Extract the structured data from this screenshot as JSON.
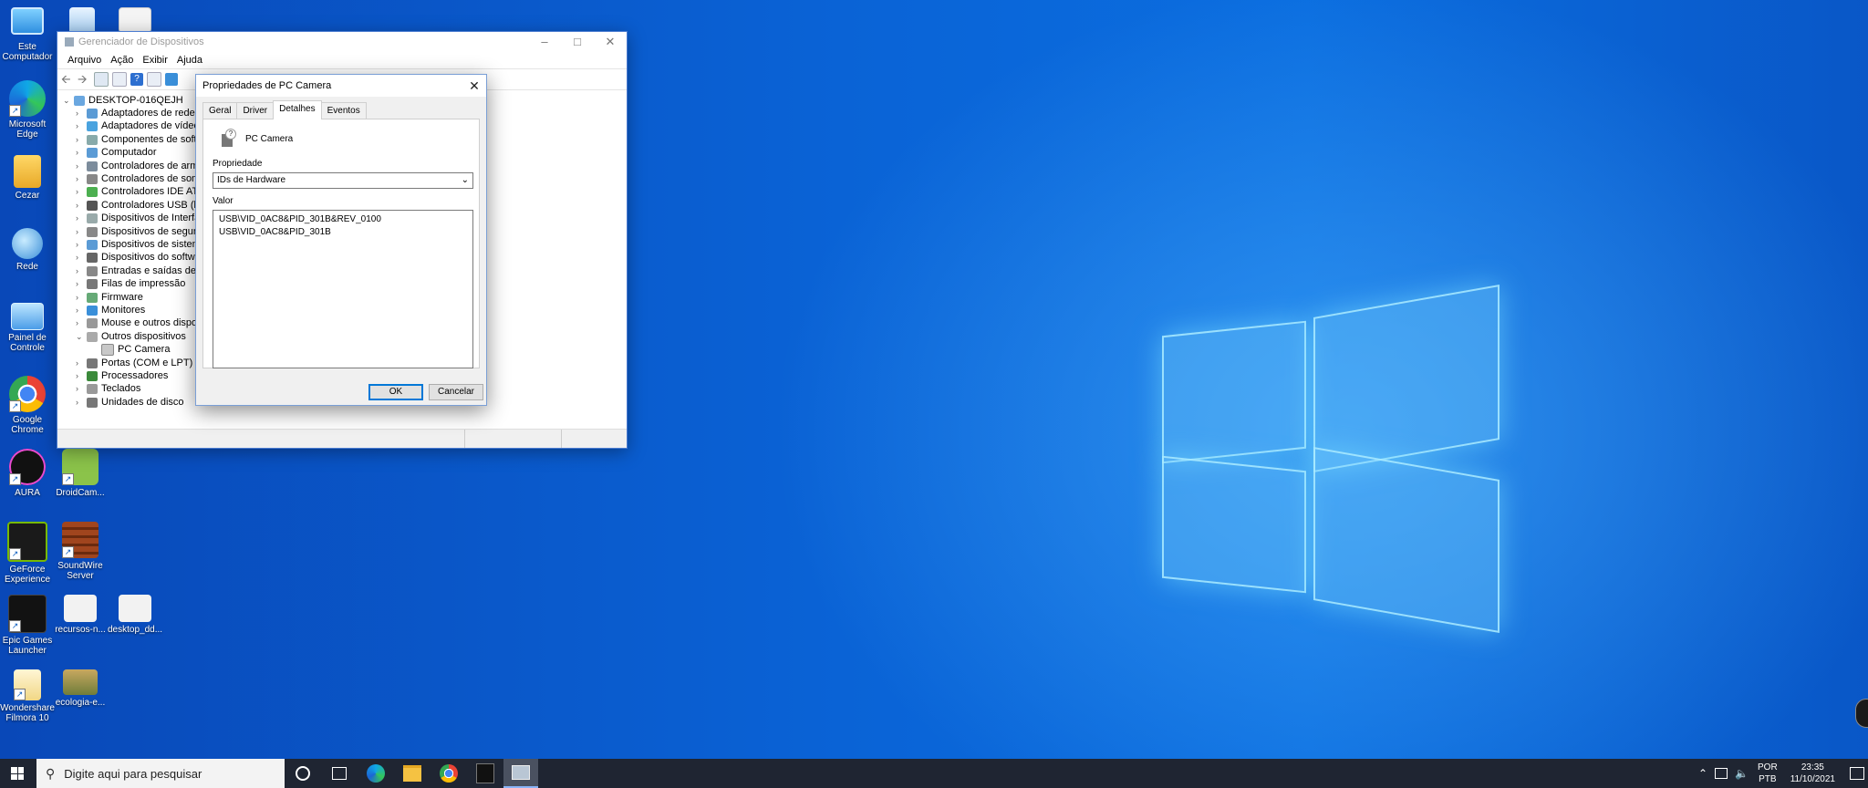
{
  "desktop": {
    "icons": [
      {
        "label": "Este Computador"
      },
      {
        "label": "Microsoft Edge"
      },
      {
        "label": "Cezar"
      },
      {
        "label": "Rede"
      },
      {
        "label": "Painel de Controle"
      },
      {
        "label": "Google Chrome"
      },
      {
        "label": "AURA"
      },
      {
        "label": "DroidCam..."
      },
      {
        "label": "GeForce Experience"
      },
      {
        "label": "SoundWire Server"
      },
      {
        "label": "Epic Games Launcher"
      },
      {
        "label": "recursos-n..."
      },
      {
        "label": "desktop_dd..."
      },
      {
        "label": "Wondershare Filmora 10"
      },
      {
        "label": "ecologia-e..."
      }
    ]
  },
  "device_manager": {
    "title": "Gerenciador de Dispositivos",
    "menu": [
      "Arquivo",
      "Ação",
      "Exibir",
      "Ajuda"
    ],
    "tree": {
      "root": "DESKTOP-016QEJH",
      "items": [
        {
          "label": "Adaptadores de rede",
          "expanded": false
        },
        {
          "label": "Adaptadores de vídeo",
          "expanded": false
        },
        {
          "label": "Componentes de softw",
          "expanded": false
        },
        {
          "label": "Computador",
          "expanded": false
        },
        {
          "label": "Controladores de armaz",
          "expanded": false
        },
        {
          "label": "Controladores de som, v",
          "expanded": false
        },
        {
          "label": "Controladores IDE ATA/",
          "expanded": false
        },
        {
          "label": "Controladores USB (bar",
          "expanded": false
        },
        {
          "label": "Dispositivos de Interface",
          "expanded": false
        },
        {
          "label": "Dispositivos de seguran",
          "expanded": false
        },
        {
          "label": "Dispositivos de sistema",
          "expanded": false
        },
        {
          "label": "Dispositivos do software",
          "expanded": false
        },
        {
          "label": "Entradas e saídas de áuc",
          "expanded": false
        },
        {
          "label": "Filas de impressão",
          "expanded": false
        },
        {
          "label": "Firmware",
          "expanded": false
        },
        {
          "label": "Monitores",
          "expanded": false
        },
        {
          "label": "Mouse e outros disposit",
          "expanded": false
        },
        {
          "label": "Outros dispositivos",
          "expanded": true
        },
        {
          "label": "PC Camera",
          "child": true
        },
        {
          "label": "Portas (COM e LPT)",
          "expanded": false
        },
        {
          "label": "Processadores",
          "expanded": false
        },
        {
          "label": "Teclados",
          "expanded": false
        },
        {
          "label": "Unidades de disco",
          "expanded": false
        }
      ]
    }
  },
  "properties_dialog": {
    "title": "Propriedades de PC Camera",
    "tabs": [
      "Geral",
      "Driver",
      "Detalhes",
      "Eventos"
    ],
    "active_tab": "Detalhes",
    "device_name": "PC Camera",
    "property_label": "Propriedade",
    "property_selected": "IDs de Hardware",
    "value_label": "Valor",
    "values": [
      "USB\\VID_0AC8&PID_301B&REV_0100",
      "USB\\VID_0AC8&PID_301B"
    ],
    "ok_label": "OK",
    "cancel_label": "Cancelar"
  },
  "taskbar": {
    "search_placeholder": "Digite aqui para pesquisar",
    "lang_line1": "POR",
    "lang_line2": "PTB",
    "time": "23:35",
    "date": "11/10/2021"
  },
  "colors": {
    "accent": "#0078d7",
    "taskbar": "#1f2532",
    "desktop": "#0a63d6"
  }
}
